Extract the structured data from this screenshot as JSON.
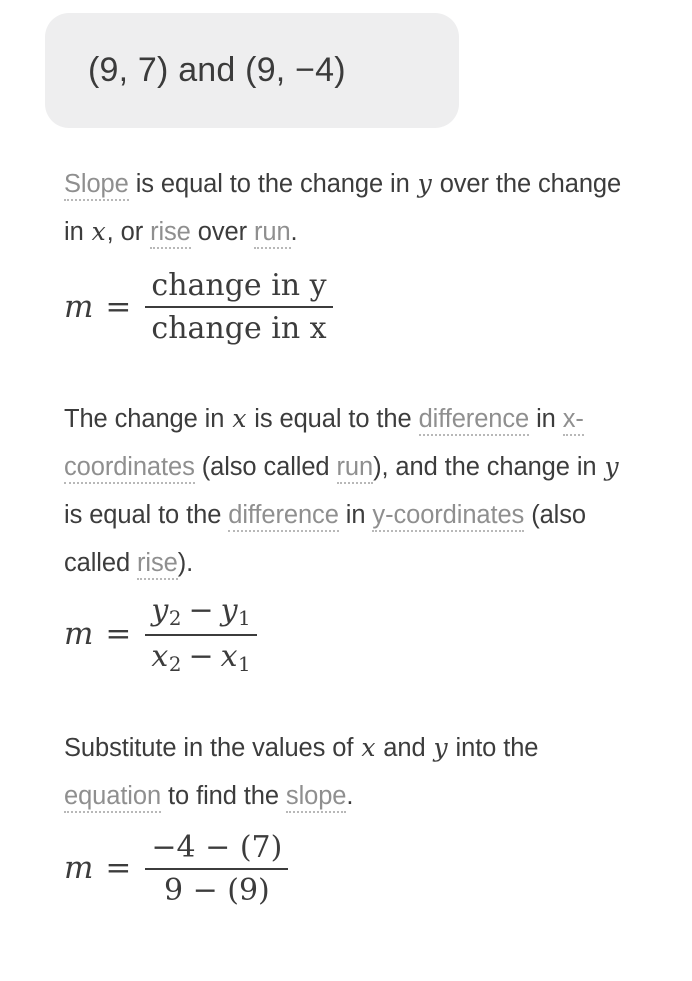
{
  "problem": {
    "label": "problem-statement",
    "point_a": "(9, 7)",
    "conjunction": "and",
    "point_b": "(9, −4)",
    "full_text": "(9, 7) and (9, −4)",
    "chip_background": "#eeeeef"
  },
  "colors": {
    "body_text": "#3c3c3c",
    "link_text": "#8f8f8f",
    "link_underline": "#b8b8b8",
    "page_background": "#ffffff"
  },
  "steps": [
    {
      "id": "step-1",
      "paragraph": {
        "seg1_link": "Slope",
        "seg2": " is equal to the change in ",
        "var1": "y",
        "seg3": " over the change in ",
        "var2": "x",
        "seg4": ", or ",
        "seg5_link": "rise",
        "seg6": " over ",
        "seg7_link": "run",
        "seg8": "."
      },
      "formula": {
        "lhs": "m",
        "eq": "=",
        "numerator": "change in y",
        "denominator": "change in x"
      }
    },
    {
      "id": "step-2",
      "paragraph": {
        "seg1": "The change in ",
        "var1": "x",
        "seg2": " is equal to the ",
        "seg3_link": "difference",
        "seg4": " in ",
        "seg5_link": "x-coordinates",
        "seg6": " (also called ",
        "seg7_link": "run",
        "seg8": "), and the change in ",
        "var2": "y",
        "seg9": " is equal to the ",
        "seg10_link": "difference",
        "seg11": " in ",
        "seg12_link": "y-coordinates",
        "seg13": " (also called ",
        "seg14_link": "rise",
        "seg15": ")."
      },
      "formula": {
        "lhs": "m",
        "eq": "=",
        "num_term1": "y",
        "num_term1_sub": "2",
        "num_op": "−",
        "num_term2": "y",
        "num_term2_sub": "1",
        "den_term1": "x",
        "den_term1_sub": "2",
        "den_op": "−",
        "den_term2": "x",
        "den_term2_sub": "1"
      }
    },
    {
      "id": "step-3",
      "paragraph": {
        "seg1": "Substitute in the values of ",
        "var1": "x",
        "seg2": " and ",
        "var2": "y",
        "seg3": " into the ",
        "seg4_link": "equation",
        "seg5": " to find the ",
        "seg6_link": "slope",
        "seg7": "."
      },
      "formula": {
        "lhs": "m",
        "eq": "=",
        "numerator": "−4 − (7)",
        "denominator": "9 − (9)"
      }
    }
  ]
}
